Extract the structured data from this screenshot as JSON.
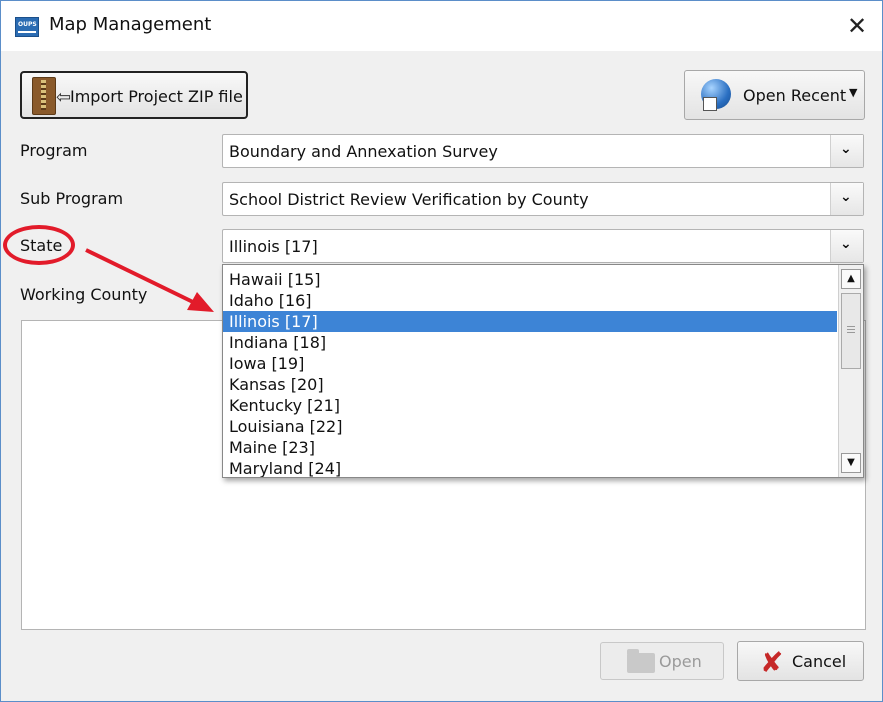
{
  "window": {
    "title": "Map Management",
    "icon_label": "OUPS"
  },
  "toolbar": {
    "import_label": "Import Project ZIP file",
    "recent_label": "Open Recent"
  },
  "form": {
    "program_label": "Program",
    "program_value": "Boundary and Annexation Survey",
    "subprogram_label": "Sub Program",
    "subprogram_value": "School District Review Verification by County",
    "state_label": "State",
    "state_value": "Illinois [17]",
    "county_label": "Working County"
  },
  "state_options": [
    "Hawaii [15]",
    "Idaho [16]",
    "Illinois [17]",
    "Indiana [18]",
    "Iowa [19]",
    "Kansas [20]",
    "Kentucky [21]",
    "Louisiana [22]",
    "Maine [23]",
    "Maryland [24]"
  ],
  "selected_state_index": 2,
  "footer": {
    "open_label": "Open",
    "cancel_label": "Cancel"
  },
  "colors": {
    "selection": "#3d84d6",
    "annotation": "#e21b2a",
    "border": "#5b8ec9"
  }
}
